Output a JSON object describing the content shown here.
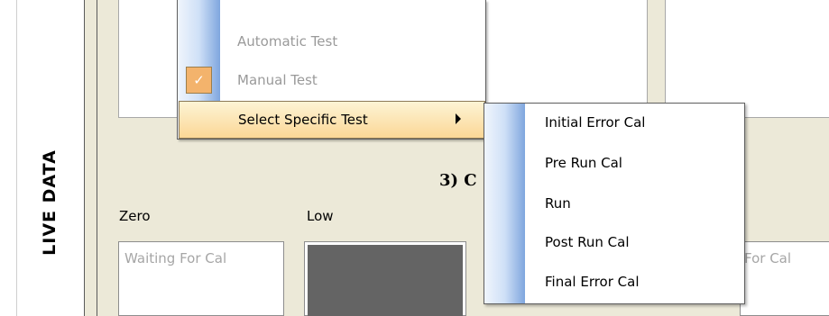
{
  "sidebar": {
    "label": "LIVE DATA"
  },
  "section": {
    "title": "3) C"
  },
  "columns": {
    "zero": {
      "label": "Zero",
      "status": "Waiting For Cal"
    },
    "low": {
      "label": "Low"
    },
    "right": {
      "status_fragment": "For Cal"
    }
  },
  "context_menu": {
    "items": [
      {
        "label": "Automatic Test",
        "enabled": false,
        "checked": false
      },
      {
        "label": "Manual Test",
        "enabled": false,
        "checked": true,
        "check_icon": "checkmark-icon"
      },
      {
        "label": "Select Specific Test",
        "highlighted": true,
        "has_submenu": true
      }
    ]
  },
  "submenu": {
    "items": [
      {
        "label": "Initial Error Cal"
      },
      {
        "label": "Pre Run Cal"
      },
      {
        "label": "Run"
      },
      {
        "label": "Post Run Cal"
      },
      {
        "label": "Final Error Cal"
      }
    ]
  },
  "colors": {
    "panel_bg": "#ece9d8",
    "highlight_top": "#fdf4d5",
    "highlight_bottom": "#fbd796",
    "gutter_blue": "#7fa6de",
    "checked_bg": "#f3b36c",
    "low_fill": "#646464"
  }
}
